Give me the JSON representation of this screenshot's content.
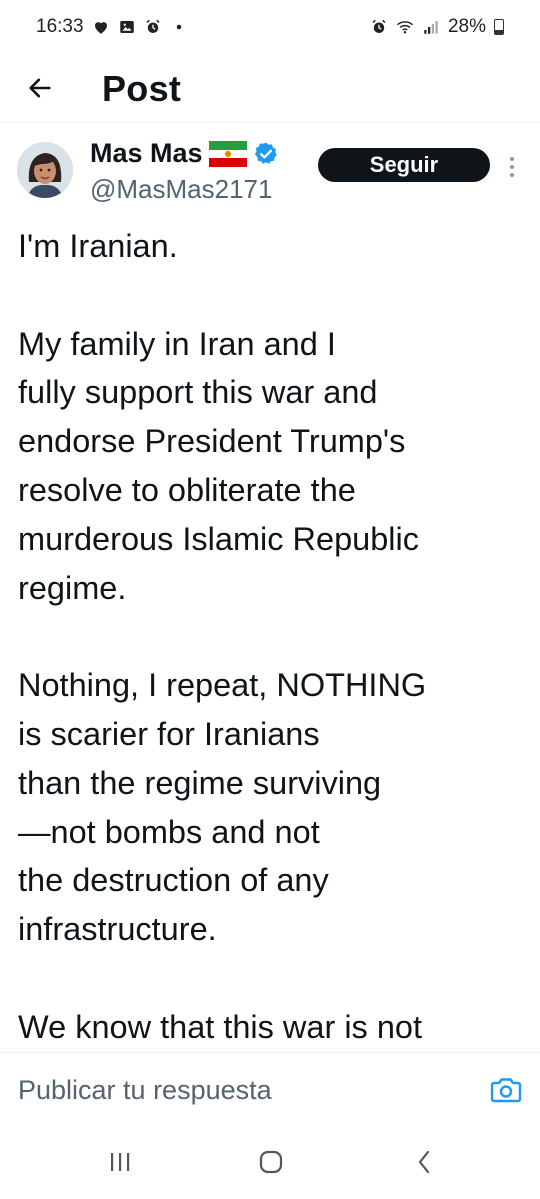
{
  "status_bar": {
    "time": "16:33",
    "battery": "28%",
    "icons_left": [
      "heart-icon",
      "image-icon",
      "alarm-icon",
      "dot-icon"
    ],
    "icons_right": [
      "alarm-icon",
      "wifi-icon",
      "signal-icon",
      "battery-icon"
    ]
  },
  "header": {
    "title": "Post",
    "back_icon": "arrow-left-icon"
  },
  "author": {
    "name": "Mas Mas",
    "handle": "@MasMas2171",
    "verified": true,
    "badge_color": "#1d9bf0",
    "follow_label": "Seguir",
    "more_icon": "more-vertical-icon"
  },
  "post": {
    "paragraphs": [
      [
        "I'm Iranian."
      ],
      [
        "My family in Iran and I",
        "fully support this war and",
        "endorse President Trump's",
        "resolve to obliterate the",
        "murderous Islamic Republic",
        "regime."
      ],
      [
        "Nothing, I repeat, NOTHING",
        "is scarier for Iranians",
        "than the regime surviving",
        "—not bombs and not",
        "the destruction of any",
        "infrastructure."
      ],
      [
        "We know that this war is not"
      ]
    ]
  },
  "reply": {
    "placeholder": "Publicar tu respuesta",
    "camera_icon": "camera-icon",
    "accent": "#1d9bf0"
  },
  "nav": {
    "icons": [
      "recent-apps-icon",
      "home-icon",
      "back-icon"
    ]
  }
}
